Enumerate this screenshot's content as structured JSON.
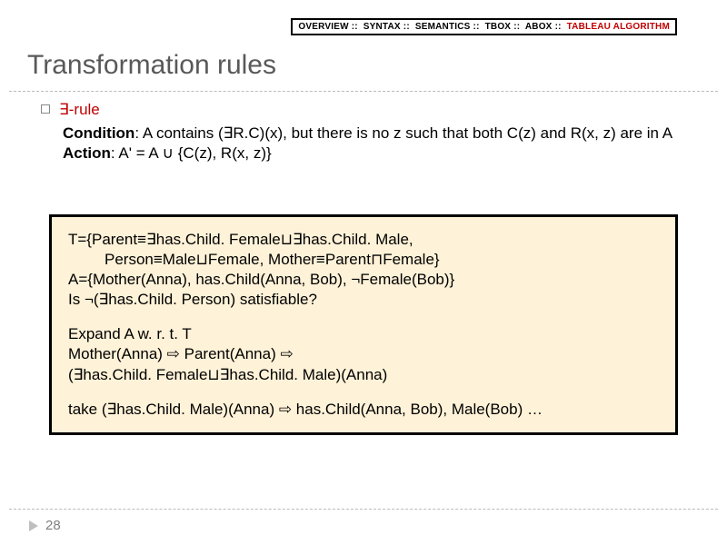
{
  "nav": {
    "items": [
      {
        "label": "OVERVIEW",
        "active": false
      },
      {
        "label": "SYNTAX",
        "active": false
      },
      {
        "label": "SEMANTICS",
        "active": false
      },
      {
        "label": "TBOX",
        "active": false
      },
      {
        "label": "ABOX",
        "active": false
      },
      {
        "label": "TABLEAU ALGORITHM",
        "active": true
      }
    ],
    "sep": "::"
  },
  "title": "Transformation rules",
  "rule": {
    "name": "∃-rule",
    "condition_label": "Condition",
    "condition_text": ": A contains (∃R.C)(x), but there is no z such that both C(z) and R(x, z) are in A",
    "action_label": "Action",
    "action_text": ": A' = A ∪ {C(z), R(x, z)}"
  },
  "box": {
    "p1_l1": "T={Parent≡∃has.Child. Female⊔∃has.Child. Male,",
    "p1_l2": "Person≡Male⊔Female, Mother≡Parent⊓Female}",
    "p1_l3": "A={Mother(Anna), has.Child(Anna, Bob), ¬Female(Bob)}",
    "p1_l4": "Is ¬(∃has.Child. Person) satisfiable?",
    "p2_l1": "Expand A w. r. t. T",
    "p2_l2": "Mother(Anna) ⇨ Parent(Anna) ⇨",
    "p2_l3": "(∃has.Child. Female⊔∃has.Child. Male)(Anna)",
    "p3_l1": "take (∃has.Child. Male)(Anna) ⇨ has.Child(Anna, Bob), Male(Bob) …"
  },
  "page_number": "28"
}
